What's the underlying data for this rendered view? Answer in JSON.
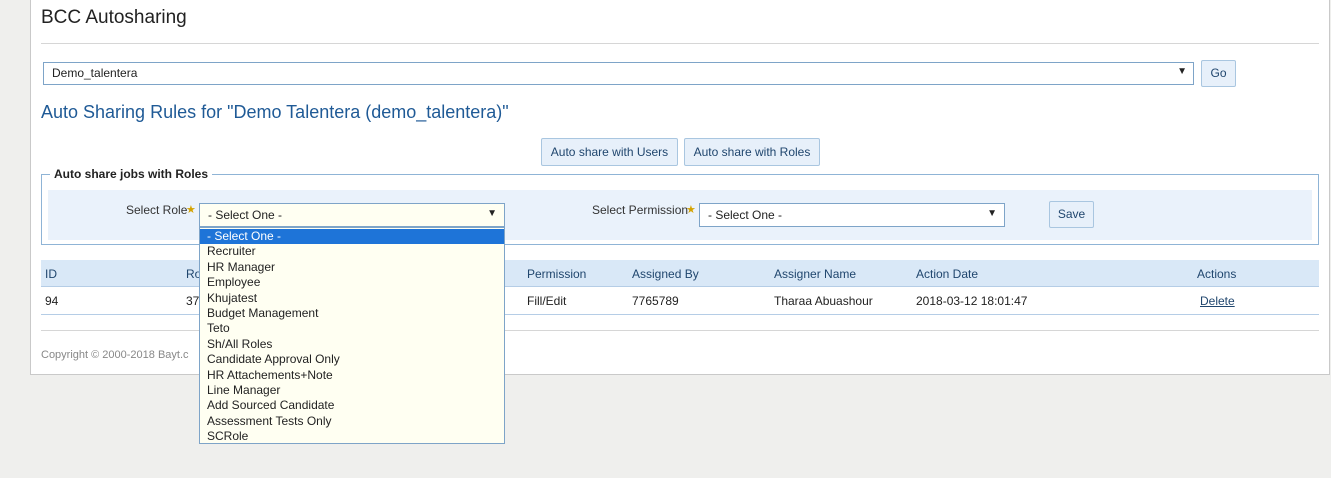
{
  "app": {
    "title": "BCC Autosharing"
  },
  "company_picker": {
    "value": "Demo_talentera",
    "go_label": "Go"
  },
  "rules_title": "Auto Sharing Rules for \"Demo Talentera (demo_talentera)\"",
  "mode_buttons": {
    "users": "Auto share with Users",
    "roles": "Auto share with Roles"
  },
  "form": {
    "legend": "Auto share jobs with Roles",
    "role_label": "Select Role",
    "role_value": "- Select One -",
    "permission_label": "Select Permission",
    "permission_value": "- Select One -",
    "save_label": "Save"
  },
  "role_options": [
    "- Select One -",
    "Recruiter",
    "HR Manager",
    "Employee",
    "Khujatest",
    "Budget Management",
    "Teto",
    "Sh/All Roles",
    "Candidate Approval Only",
    "HR Attachements+Note",
    "Line Manager",
    "Add Sourced Candidate",
    "Assessment Tests Only",
    "SCRole"
  ],
  "table": {
    "columns": {
      "id": "ID",
      "role": "Ro",
      "permission": "Permission",
      "assigned_by": "Assigned By",
      "assigner_name": "Assigner Name",
      "action_date": "Action Date",
      "actions": "Actions"
    },
    "rows": [
      {
        "id": "94",
        "role": "37",
        "permission": "Fill/Edit",
        "assigned_by": "7765789",
        "assigner_name": "Tharaa Abuashour",
        "action_date": "2018-03-12 18:01:47",
        "action": "Delete"
      }
    ]
  },
  "footer": {
    "copyright": "Copyright © 2000-2018 Bayt.c"
  }
}
